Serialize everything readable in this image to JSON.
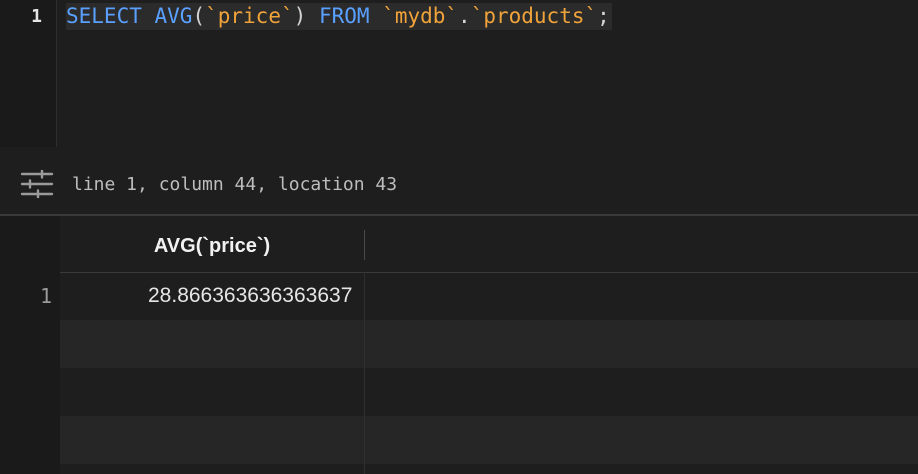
{
  "editor": {
    "line_number": "1",
    "tokens": {
      "select": "SELECT",
      "avg": "AVG",
      "open_paren": "(",
      "col": "`price`",
      "close_paren": ")",
      "from": "FROM",
      "db": "`mydb`",
      "dot": ".",
      "table": "`products`",
      "semicolon": ";"
    }
  },
  "status_bar": {
    "icon": "settings-sliders-icon",
    "cursor_info": "line 1, column 44, location 43"
  },
  "results": {
    "columns": [
      "AVG(`price`)"
    ],
    "rows": [
      {
        "num": "1",
        "values": [
          "28.866363636363637"
        ]
      }
    ]
  },
  "colors": {
    "keyword": "#5aa0ff",
    "identifier": "#f0a33a",
    "background": "#1e1e1e"
  }
}
